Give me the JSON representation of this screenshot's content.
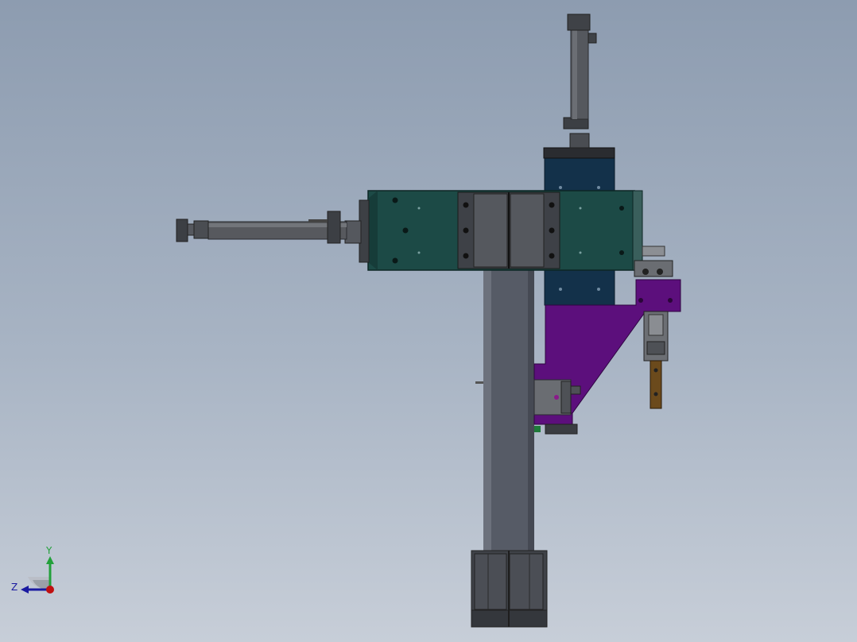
{
  "viewport": {
    "background_top": "#8d9cb0",
    "background_bottom": "#c7ced8"
  },
  "model": {
    "colors": {
      "green_body": "#1b4a45",
      "purple_bracket": "#5a0f7a",
      "dark_blue_block": "#12304a",
      "column_gray": "#585d68",
      "cylinder_gray": "#5e6166",
      "gripper_brown": "#6a4a1e",
      "base_dark": "#3c3f45"
    }
  },
  "triad": {
    "y_label": "Y",
    "z_label": "Z",
    "y_color": "#22a03a",
    "z_color": "#1a1aa0",
    "x_color": "#c01010"
  }
}
